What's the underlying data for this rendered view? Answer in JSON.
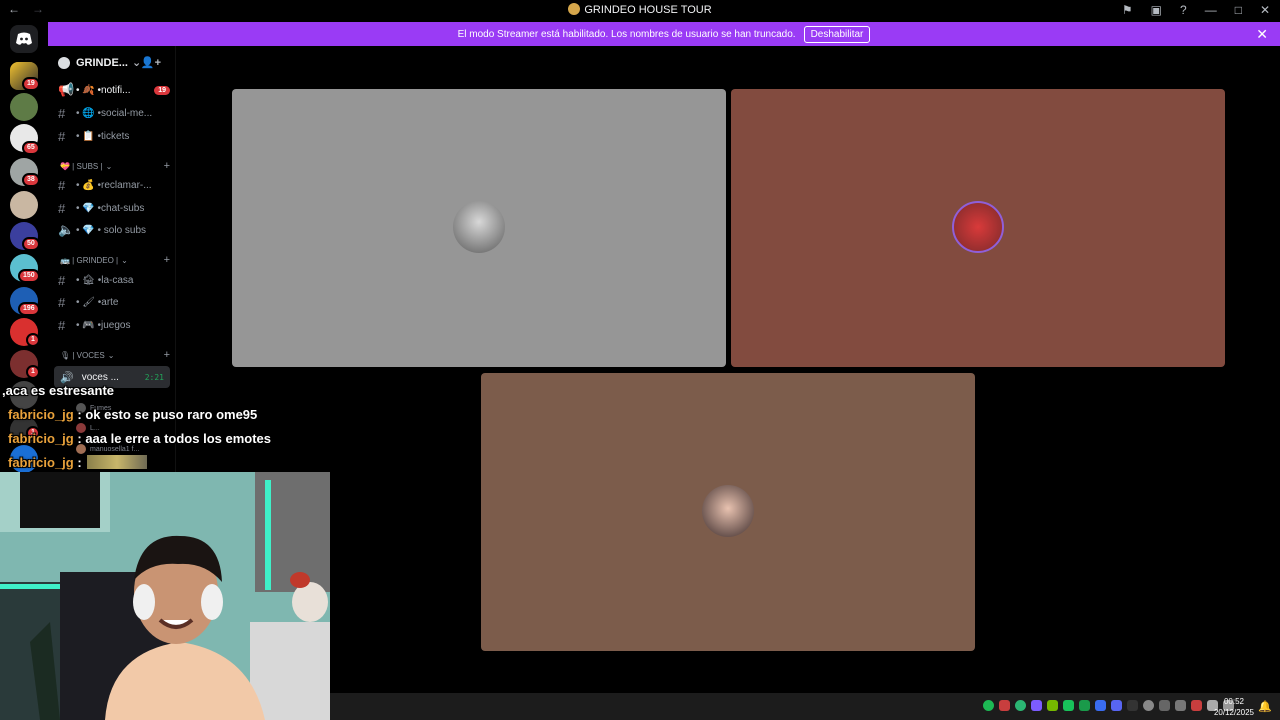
{
  "window": {
    "title": "GRINDEO HOUSE TOUR",
    "back_glyph": "←",
    "forward_glyph": "→"
  },
  "banner": {
    "text": "El modo Streamer está habilitado. Los nombres de usuario se han truncado.",
    "button": "Deshabilitar",
    "close_glyph": "✕"
  },
  "rail": {
    "badges": [
      "19",
      "65",
      "38",
      "50",
      "150",
      "196",
      "1",
      "1",
      "1"
    ]
  },
  "server": {
    "name": "GRINDE...",
    "channels_top": [
      {
        "name": "• 🍂 •notifi...",
        "badge": "19"
      },
      {
        "name": "• 🌐 •social-me..."
      },
      {
        "name": "• 📋 •tickets"
      }
    ],
    "subs_category": "💝 | SUBS |",
    "subs_channels": [
      {
        "name": "• 💰 •reclamar-..."
      },
      {
        "name": "• 💎 •chat-subs"
      },
      {
        "name": "• 💎 • solo subs"
      }
    ],
    "grindeo_category": "🚌 | GRINDEO |",
    "grindeo_channels": [
      {
        "name": "• 🏚 •la-casa"
      },
      {
        "name": "• 🖌 •arte"
      },
      {
        "name": "• 🎮 •juegos"
      }
    ],
    "voces_category": "🎙 | VOCES",
    "voice_channel": {
      "name": "voces ...",
      "time": "2:21"
    },
    "voice_users": [
      "Fumes",
      "L...",
      "manuosella1 f..."
    ]
  },
  "chat": {
    "lines": [
      {
        "user": "",
        "sep": "",
        "text": ",aca es estresante"
      },
      {
        "user": "fabricio_jg",
        "sep": " : ",
        "text": "ok esto se puso raro ome95"
      },
      {
        "user": "fabricio_jg",
        "sep": " : ",
        "text": "aaa le erre a todos los emotes"
      },
      {
        "user": "fabricio_jg",
        "sep": " : ",
        "text": ""
      }
    ]
  },
  "taskbar": {
    "time": "00:52",
    "date": "20/12/2025"
  },
  "colors": {
    "banner": "#9a3bf5",
    "tile1": "#969696",
    "tile2": "#824b3f",
    "tile3": "#7c5c4b",
    "badge": "#da373c",
    "voice_green": "#23a55a",
    "chat_user": "#e9a23b"
  },
  "icons": [
    "discord-icon",
    "speaker-icon",
    "flag-icon",
    "help-icon",
    "gear-icon",
    "add-user-icon",
    "plus-icon",
    "notification-icon"
  ]
}
